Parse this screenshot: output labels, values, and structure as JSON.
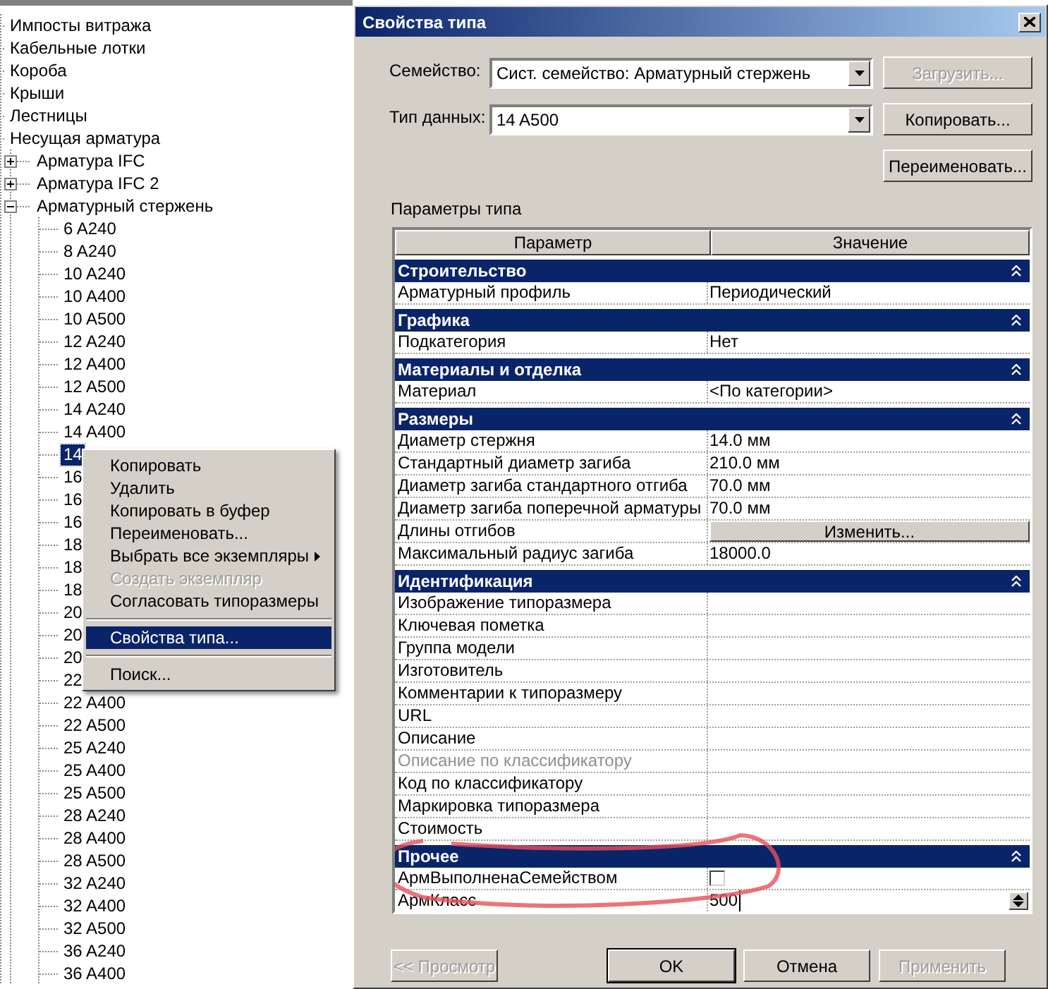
{
  "tree": {
    "items": [
      {
        "label": "Импосты витража"
      },
      {
        "label": "Кабельные лотки"
      },
      {
        "label": "Короба"
      },
      {
        "label": "Крыши"
      },
      {
        "label": "Лестницы"
      },
      {
        "label": "Несущая арматура",
        "children": [
          {
            "label": "Арматура IFC",
            "expanded": false
          },
          {
            "label": "Арматура IFC 2",
            "expanded": false
          },
          {
            "label": "Арматурный стержень",
            "expanded": true,
            "children": [
              {
                "label": "6 A240",
                "selected": false
              },
              {
                "label": "8 A240",
                "selected": false
              },
              {
                "label": "10 A240",
                "selected": false
              },
              {
                "label": "10 A400",
                "selected": false
              },
              {
                "label": "10 A500",
                "selected": false
              },
              {
                "label": "12 A240",
                "selected": false
              },
              {
                "label": "12 A400",
                "selected": false
              },
              {
                "label": "12 A500",
                "selected": false
              },
              {
                "label": "14 A240",
                "selected": false
              },
              {
                "label": "14 A400",
                "selected": false
              },
              {
                "label": "14",
                "selected": true
              },
              {
                "label": "16",
                "selected": false
              },
              {
                "label": "16",
                "selected": false
              },
              {
                "label": "16",
                "selected": false
              },
              {
                "label": "18",
                "selected": false
              },
              {
                "label": "18",
                "selected": false
              },
              {
                "label": "18",
                "selected": false
              },
              {
                "label": "20",
                "selected": false
              },
              {
                "label": "20",
                "selected": false
              },
              {
                "label": "20",
                "selected": false
              },
              {
                "label": "22",
                "selected": false
              },
              {
                "label": "22 A400",
                "selected": false
              },
              {
                "label": "22 A500",
                "selected": false
              },
              {
                "label": "25 A240",
                "selected": false
              },
              {
                "label": "25 A400",
                "selected": false
              },
              {
                "label": "25 A500",
                "selected": false
              },
              {
                "label": "28 A240",
                "selected": false
              },
              {
                "label": "28 A400",
                "selected": false
              },
              {
                "label": "28 A500",
                "selected": false
              },
              {
                "label": "32 A240",
                "selected": false
              },
              {
                "label": "32 A400",
                "selected": false
              },
              {
                "label": "32 A500",
                "selected": false
              },
              {
                "label": "36 A240",
                "selected": false
              },
              {
                "label": "36 A400",
                "selected": false
              }
            ]
          }
        ]
      }
    ]
  },
  "context_menu": {
    "items": [
      {
        "kind": "item",
        "label": "Копировать",
        "disabled": false,
        "selected": false,
        "submenu": false
      },
      {
        "kind": "item",
        "label": "Удалить",
        "disabled": false,
        "selected": false,
        "submenu": false
      },
      {
        "kind": "item",
        "label": "Копировать в буфер",
        "disabled": false,
        "selected": false,
        "submenu": false
      },
      {
        "kind": "item",
        "label": "Переименовать...",
        "disabled": false,
        "selected": false,
        "submenu": false
      },
      {
        "kind": "item",
        "label": "Выбрать все экземпляры",
        "disabled": false,
        "selected": false,
        "submenu": true
      },
      {
        "kind": "item",
        "label": "Создать экземпляр",
        "disabled": true,
        "selected": false,
        "submenu": false
      },
      {
        "kind": "item",
        "label": "Согласовать типоразмеры",
        "disabled": false,
        "selected": false,
        "submenu": false
      },
      {
        "kind": "separator"
      },
      {
        "kind": "item",
        "label": "Свойства типа...",
        "disabled": false,
        "selected": true,
        "submenu": false
      },
      {
        "kind": "separator"
      },
      {
        "kind": "item",
        "label": "Поиск...",
        "disabled": false,
        "selected": false,
        "submenu": false
      }
    ]
  },
  "dialog": {
    "title": "Свойства типа",
    "family": {
      "label": "Семейство:",
      "value": "Сист. семейство: Арматурный стержень",
      "button": {
        "label": "Загрузить...",
        "disabled": true
      }
    },
    "type": {
      "label": "Тип данных:",
      "value": "14 A500",
      "button": {
        "label": "Копировать...",
        "disabled": false
      }
    },
    "rename_button": {
      "label": "Переименовать...",
      "disabled": false
    },
    "section_label": "Параметры типа",
    "table": {
      "columns": [
        "Параметр",
        "Значение"
      ],
      "groups": [
        {
          "title": "Строительство",
          "expanded": true,
          "rows": [
            {
              "kind": "text",
              "name": "Арматурный профиль",
              "value": "Периодический",
              "disabled": false
            }
          ]
        },
        {
          "title": "Графика",
          "expanded": true,
          "rows": [
            {
              "kind": "text",
              "name": "Подкатегория",
              "value": "Нет",
              "disabled": false
            }
          ]
        },
        {
          "title": "Материалы и отделка",
          "expanded": true,
          "rows": [
            {
              "kind": "text",
              "name": "Материал",
              "value": "<По категории>",
              "disabled": false
            }
          ]
        },
        {
          "title": "Размеры",
          "expanded": true,
          "rows": [
            {
              "kind": "text",
              "name": "Диаметр стержня",
              "value": "14.0 мм",
              "disabled": false
            },
            {
              "kind": "text",
              "name": "Стандартный диаметр загиба",
              "value": "210.0 мм",
              "disabled": false
            },
            {
              "kind": "text",
              "name": "Диаметр загиба стандартного отгиба",
              "value": "70.0 мм",
              "disabled": false
            },
            {
              "kind": "text",
              "name": "Диаметр загиба поперечной арматуры",
              "value": "70.0 мм",
              "disabled": false
            },
            {
              "kind": "button",
              "name": "Длины отгибов",
              "value": "Изменить...",
              "disabled": false
            },
            {
              "kind": "text",
              "name": "Максимальный радиус загиба",
              "value": "18000.0",
              "disabled": false
            }
          ]
        },
        {
          "title": "Идентификация",
          "expanded": true,
          "rows": [
            {
              "kind": "text",
              "name": "Изображение типоразмера",
              "disabled": false
            },
            {
              "kind": "text",
              "name": "Ключевая пометка",
              "disabled": false
            },
            {
              "kind": "text",
              "name": "Группа модели",
              "disabled": false
            },
            {
              "kind": "text",
              "name": "Изготовитель",
              "disabled": false
            },
            {
              "kind": "text",
              "name": "Комментарии к типоразмеру",
              "disabled": false
            },
            {
              "kind": "text",
              "name": "URL",
              "disabled": false
            },
            {
              "kind": "text",
              "name": "Описание",
              "disabled": false
            },
            {
              "kind": "text",
              "name": "Описание по классификатору",
              "disabled": true
            },
            {
              "kind": "text",
              "name": "Код по классификатору",
              "disabled": false
            },
            {
              "kind": "text",
              "name": "Маркировка типоразмера",
              "disabled": false
            },
            {
              "kind": "text",
              "name": "Стоимость",
              "disabled": false
            }
          ]
        },
        {
          "title": "Прочее",
          "expanded": true,
          "rows": [
            {
              "kind": "checkbox",
              "name": "АрмВыполненаСемейством",
              "checked": false,
              "disabled": false
            },
            {
              "kind": "number",
              "name": "АрмКласс",
              "value": "500",
              "disabled": false
            }
          ]
        }
      ]
    },
    "buttons": [
      {
        "label": "<< Просмотр",
        "disabled": true,
        "default": false
      },
      {
        "label": "OK",
        "disabled": false,
        "default": true
      },
      {
        "label": "Отмена",
        "disabled": false,
        "default": false
      },
      {
        "label": "Применить",
        "disabled": true,
        "default": false
      }
    ]
  }
}
